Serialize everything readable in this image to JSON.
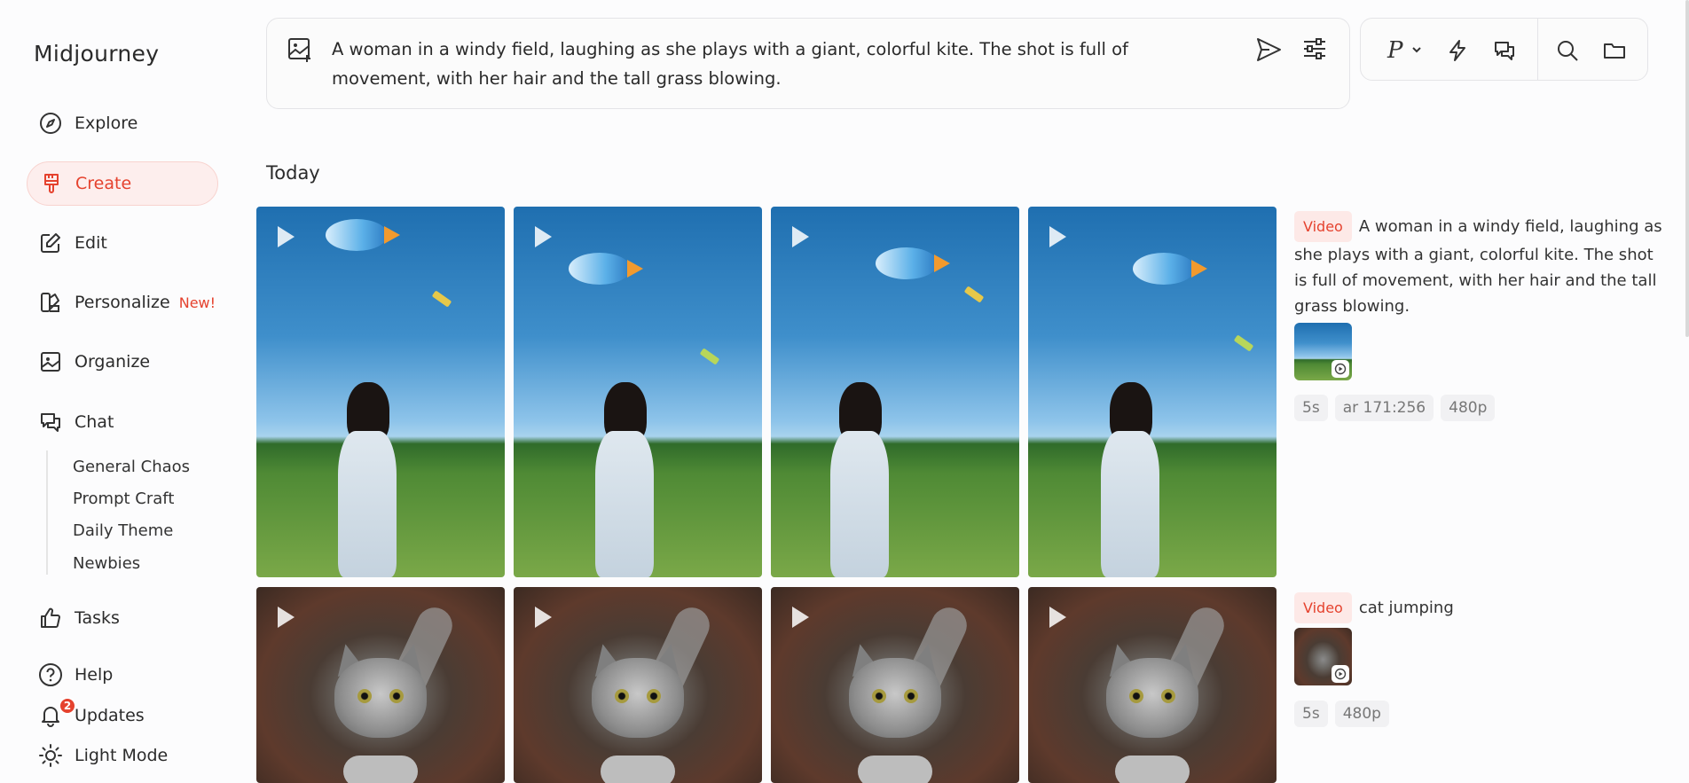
{
  "app": {
    "title": "Midjourney"
  },
  "sidebar": {
    "items": [
      {
        "label": "Explore",
        "icon": "compass-icon"
      },
      {
        "label": "Create",
        "icon": "brush-icon",
        "active": true
      },
      {
        "label": "Edit",
        "icon": "edit-icon"
      },
      {
        "label": "Personalize",
        "icon": "personalize-icon",
        "badge": "New!"
      },
      {
        "label": "Organize",
        "icon": "image-icon"
      },
      {
        "label": "Chat",
        "icon": "chat-icon"
      }
    ],
    "chat_rooms": [
      "General Chaos",
      "Prompt Craft",
      "Daily Theme",
      "Newbies"
    ],
    "bottom": [
      {
        "label": "Tasks",
        "icon": "thumbs-up-icon"
      },
      {
        "label": "Help",
        "icon": "help-icon"
      },
      {
        "label": "Updates",
        "icon": "bell-icon",
        "count": "2"
      },
      {
        "label": "Light Mode",
        "icon": "sun-icon"
      }
    ]
  },
  "prompt": {
    "text": "A woman in a windy field, laughing as she plays with a giant, colorful kite. The shot is full of movement, with her hair and the tall grass blowing."
  },
  "toolbar": {
    "personalize_letter": "P"
  },
  "feed": {
    "section": "Today",
    "jobs": [
      {
        "tag": "Video",
        "prompt": "A woman in a windy field, laughing as she plays with a giant, colorful kite. The shot is full of movement, with her hair and the tall grass blowing.",
        "chips": [
          "5s",
          "ar 171:256",
          "480p"
        ]
      },
      {
        "tag": "Video",
        "prompt": "cat jumping",
        "chips": [
          "5s",
          "480p"
        ]
      }
    ]
  },
  "colors": {
    "accent": "#e5422e",
    "accent_bg": "#fdeeed"
  }
}
